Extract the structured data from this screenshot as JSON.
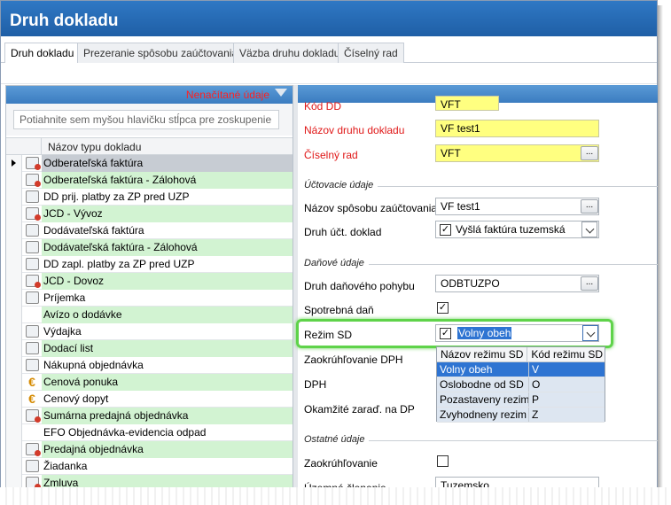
{
  "window": {
    "title": "Druh dokladu"
  },
  "tabs": [
    {
      "label": "Druh dokladu",
      "active": true
    },
    {
      "label": "Prezeranie spôsobu zaúčtovania"
    },
    {
      "label": "Väzba druhu dokladu"
    },
    {
      "label": "Číselný rad"
    }
  ],
  "left": {
    "header": "Nenačítané údaje",
    "group_hint": "Potiahnite sem myšou hlavičku stĺpca pre zoskupenie",
    "column": "Názov typu dokladu",
    "rows": [
      {
        "label": "Odberateľská faktúra",
        "icon": "invoice-out-icon",
        "style": "sel"
      },
      {
        "label": "Odberateľská faktúra - Zálohová",
        "icon": "invoice-out-icon",
        "style": "green"
      },
      {
        "label": "DD prij. platby za ZP pred UZP",
        "icon": "payment-doc-icon",
        "style": ""
      },
      {
        "label": "JCD - Vývoz",
        "icon": "customs-export-icon",
        "style": "green"
      },
      {
        "label": "Dodávateľská faktúra",
        "icon": "invoice-in-icon",
        "style": ""
      },
      {
        "label": "Dodávateľská faktúra - Zálohová",
        "icon": "invoice-in-icon",
        "style": "green"
      },
      {
        "label": "DD zapl. platby za ZP pred UZP",
        "icon": "payment-doc-icon",
        "style": ""
      },
      {
        "label": "JCD - Dovoz",
        "icon": "customs-import-icon",
        "style": "green"
      },
      {
        "label": "Príjemka",
        "icon": "receipt-icon",
        "style": ""
      },
      {
        "label": "Avízo o dodávke",
        "icon": "",
        "style": "green"
      },
      {
        "label": "Výdajka",
        "icon": "issue-slip-icon",
        "style": ""
      },
      {
        "label": "Dodací list",
        "icon": "delivery-note-icon",
        "style": "green"
      },
      {
        "label": "Nákupná objednávka",
        "icon": "purchase-order-icon",
        "style": ""
      },
      {
        "label": "Cenová ponuka",
        "icon": "euro-icon",
        "style": "green"
      },
      {
        "label": "Cenový dopyt",
        "icon": "euro-icon",
        "style": ""
      },
      {
        "label": "Sumárna predajná objednávka",
        "icon": "sales-order-icon",
        "style": "green"
      },
      {
        "label": "EFO Objednávka-evidencia odpad",
        "icon": "",
        "style": ""
      },
      {
        "label": "Predajná objednávka",
        "icon": "sales-order-icon",
        "style": "green"
      },
      {
        "label": "Žiadanka",
        "icon": "request-icon",
        "style": ""
      },
      {
        "label": "Zmluva",
        "icon": "contract-icon",
        "style": "green"
      }
    ]
  },
  "form": {
    "kod_label": "Kód DD",
    "kod_value": "VFT",
    "nazov_label": "Názov druhu dokladu",
    "nazov_value": "VF test1",
    "ciselny_label": "Číselný rad",
    "ciselny_value": "VFT",
    "sec_uct": "Účtovacie údaje",
    "sposob_label": "Názov spôsobu zaúčtovania",
    "sposob_value": "VF test1",
    "druh_uct_label": "Druh účt. doklad",
    "druh_uct_value": "Vyšlá faktúra tuzemská",
    "sec_dan": "Daňové údaje",
    "pohyb_label": "Druh daňového pohybu",
    "pohyb_value": "ODBTUZPO",
    "spotrebna_label": "Spotrebná daň",
    "rezim_label": "Režim SD",
    "rezim_value": "Volny obeh",
    "zaokr_dph_label": "Zaokrúhľovanie DPH",
    "dph_label": "DPH",
    "okamzite_label": "Okamžité zaraď. na DP",
    "sec_ost": "Ostatné údaje",
    "zaokr_label": "Zaokrúhľovanie",
    "uzemne_label": "Územné členenie",
    "uzemne_value": "Tuzemsko",
    "dots": "..."
  },
  "dropdown": {
    "col1": "Názov režimu SD",
    "col2": "Kód režimu SD",
    "rows": [
      {
        "name": "Volny obeh",
        "code": "V"
      },
      {
        "name": "Oslobodne od SD",
        "code": "O"
      },
      {
        "name": "Pozastaveny rezim",
        "code": "P"
      },
      {
        "name": "Zvyhodneny rezim",
        "code": "Z"
      }
    ]
  },
  "colors": {
    "title_bar": "#2f78c4",
    "green_row": "#d2f3d2",
    "yellow_field": "#ffff80",
    "highlight": "#5fd34a",
    "selected_option": "#2e74d2"
  }
}
